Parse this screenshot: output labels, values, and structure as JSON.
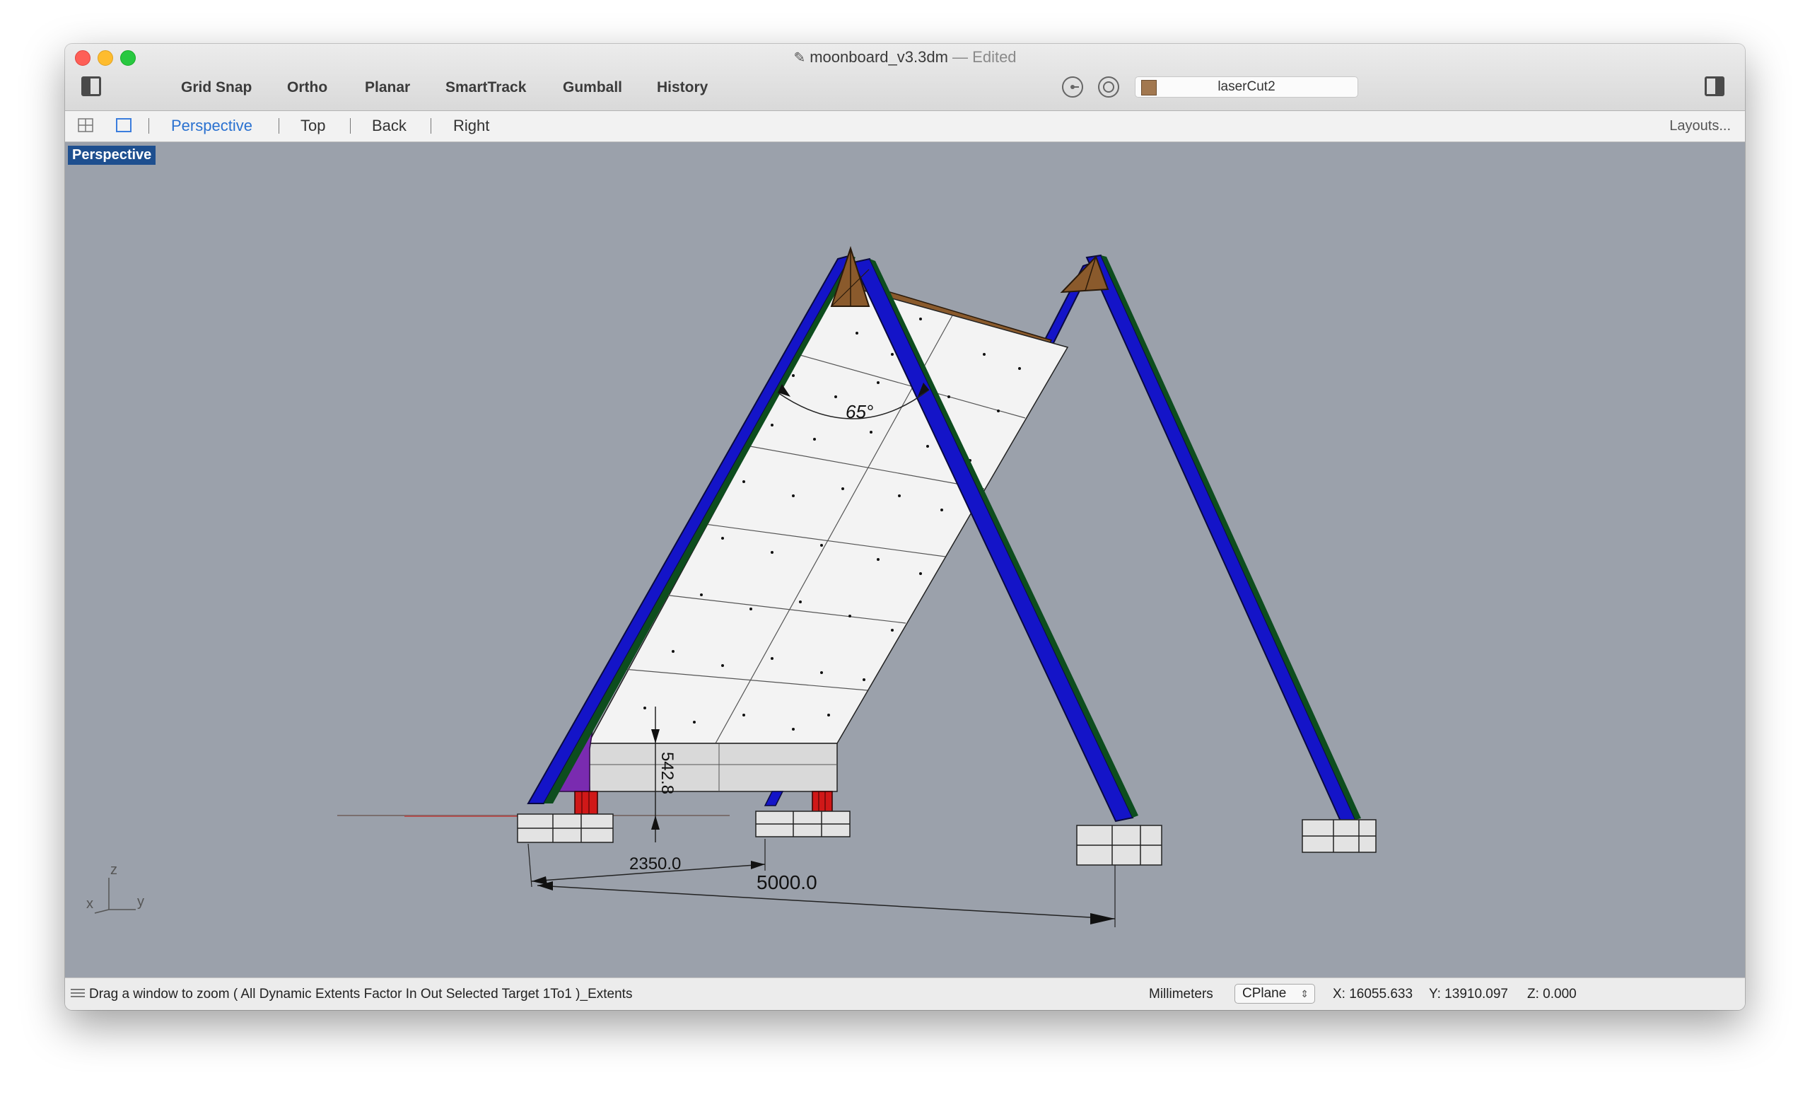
{
  "window": {
    "title": "moonboard_v3.3dm",
    "title_separator": "—",
    "title_status": "Edited"
  },
  "toolbar": {
    "buttons": [
      "Grid Snap",
      "Ortho",
      "Planar",
      "SmartTrack",
      "Gumball",
      "History"
    ],
    "layer": {
      "name": "laserCut2",
      "color": "#a27850"
    }
  },
  "viewbar": {
    "tabs": [
      "Perspective",
      "Top",
      "Back",
      "Right"
    ],
    "active_tab": "Perspective",
    "layouts_label": "Layouts..."
  },
  "viewport": {
    "label": "Perspective",
    "annotations": {
      "angle": "65°",
      "height": "542.8",
      "dim_short": "2350.0",
      "dim_long": "5000.0"
    },
    "axes": {
      "z": "z",
      "x": "x",
      "y": "y"
    },
    "colors": {
      "background": "#9ba1ab",
      "frame": "#1414c8",
      "bracket": "#8a5a2c",
      "panel": "#f3f3f3",
      "footing": "#e3e3e3",
      "post": "#d01818",
      "wedge": "#7a2bb0"
    }
  },
  "statusbar": {
    "command": "Drag a window to zoom ( All Dynamic Extents Factor In Out Selected Target 1To1 )_Extents",
    "units": "Millimeters",
    "cplane": "CPlane",
    "x": "X: 16055.633",
    "y": "Y: 13910.097",
    "z": "Z: 0.000"
  }
}
